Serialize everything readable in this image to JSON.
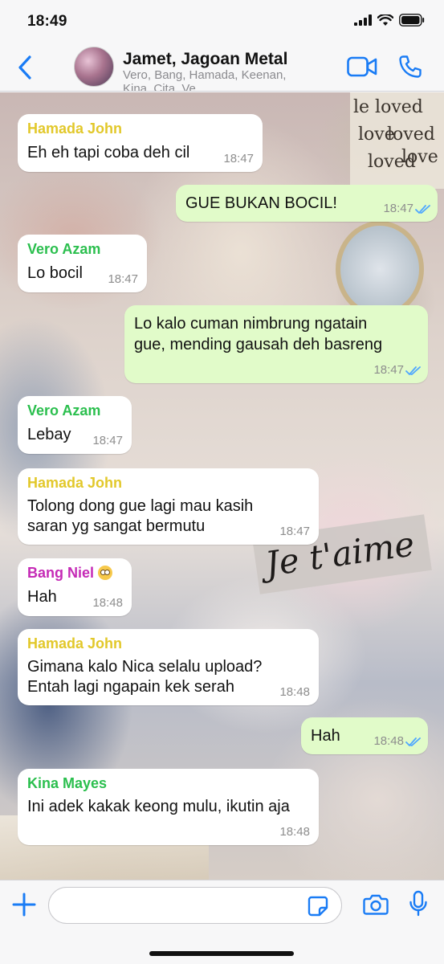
{
  "status": {
    "time": "18:49"
  },
  "header": {
    "title": "Jamet, Jagoan Metal",
    "members": "Vero, Bang, Hamada, Keenan, Kina, Cita, Ve"
  },
  "colors": {
    "accent": "#1a7cf5",
    "outgoing_bubble": "#e1fbc9",
    "incoming_bubble": "#ffffff",
    "hamada": "#e2c82a",
    "vero": "#2bbf4e",
    "bang": "#c52ab6",
    "kina": "#2bbf4e",
    "read_ticks": "#4fa7ff"
  },
  "wallpaper": {
    "words": [
      "le loved",
      "loved",
      "love",
      "love",
      "loved"
    ],
    "label": "Je t'aime"
  },
  "messages": [
    {
      "direction": "in",
      "sender": "Hamada John",
      "lines": [
        "Eh eh tapi coba deh cil"
      ],
      "time": "18:47"
    },
    {
      "direction": "out",
      "lines": [
        "GUE BUKAN BOCIL!"
      ],
      "time": "18:47",
      "read": true
    },
    {
      "direction": "in",
      "sender": "Vero Azam",
      "lines": [
        "Lo bocil"
      ],
      "time": "18:47"
    },
    {
      "direction": "out",
      "lines": [
        "Lo kalo cuman nimbrung ngatain",
        "gue, mending gausah deh basreng"
      ],
      "time": "18:47",
      "read": true
    },
    {
      "direction": "in",
      "sender": "Vero Azam",
      "lines": [
        "Lebay"
      ],
      "time": "18:47"
    },
    {
      "direction": "in",
      "sender": "Hamada John",
      "lines": [
        "Tolong dong gue lagi mau kasih",
        "saran yg sangat bermutu"
      ],
      "time": "18:47"
    },
    {
      "direction": "in",
      "sender": "Bang Niel",
      "sender_emoji": "eye-roll-emoji",
      "lines": [
        "Hah"
      ],
      "time": "18:48"
    },
    {
      "direction": "in",
      "sender": "Hamada John",
      "lines": [
        "Gimana kalo Nica selalu upload?",
        "Entah lagi ngapain kek serah"
      ],
      "time": "18:48"
    },
    {
      "direction": "out",
      "lines": [
        "Hah"
      ],
      "time": "18:48",
      "read": true
    },
    {
      "direction": "in",
      "sender": "Kina Mayes",
      "lines": [
        "Ini adek kakak keong mulu, ikutin aja"
      ],
      "time": "18:48"
    }
  ],
  "input": {
    "placeholder": ""
  }
}
